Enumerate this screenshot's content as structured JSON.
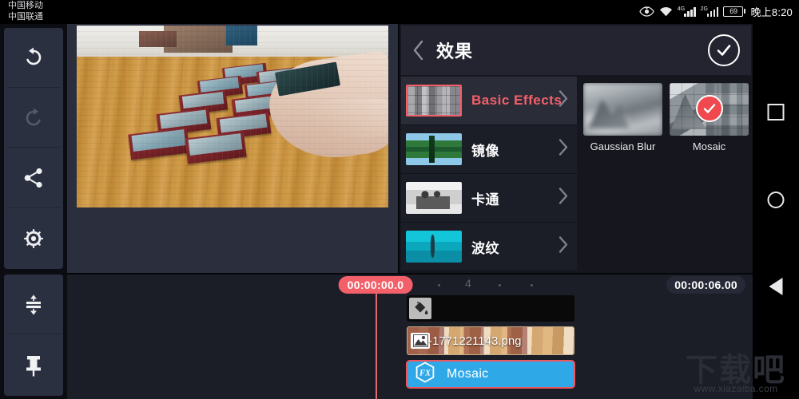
{
  "status_bar": {
    "carrier_1": "中国移动",
    "carrier_2": "中国联通",
    "icons": [
      "eye-icon",
      "wifi-icon",
      "signal-4g-icon",
      "signal-2g-icon",
      "battery-icon"
    ],
    "network_1": "4G",
    "network_2": "2G",
    "battery_percent": "69",
    "time": "晚上8:20"
  },
  "toolbar": {
    "buttons": [
      {
        "name": "undo-button",
        "icon": "undo-icon",
        "enabled": true
      },
      {
        "name": "redo-button",
        "icon": "redo-icon",
        "enabled": false
      },
      {
        "name": "share-button",
        "icon": "share-icon",
        "enabled": true
      },
      {
        "name": "settings-button",
        "icon": "gear-icon",
        "enabled": true
      },
      {
        "name": "track-height-button",
        "icon": "expand-rows-icon",
        "enabled": true
      },
      {
        "name": "pin-button",
        "icon": "pin-icon",
        "enabled": true
      }
    ]
  },
  "effects_panel": {
    "title": "效果",
    "back_icon": "chevron-left-icon",
    "confirm_icon": "check-circle-icon",
    "accent_color": "#f4606a",
    "categories": [
      {
        "label": "Basic Effects",
        "thumb": "mosaic-gray-thumb",
        "selected": true
      },
      {
        "label": "镜像",
        "thumb": "mirror-thumb",
        "selected": false
      },
      {
        "label": "卡通",
        "thumb": "cartoon-thumb",
        "selected": false
      },
      {
        "label": "波纹",
        "thumb": "ripple-thumb",
        "selected": false
      }
    ],
    "effects": [
      {
        "label": "Gaussian Blur",
        "thumb": "mountain-blur-thumb",
        "selected": false
      },
      {
        "label": "Mosaic",
        "thumb": "mountain-mosaic-thumb",
        "selected": true
      }
    ]
  },
  "timeline": {
    "playhead_time": "00:00:00.0",
    "total_duration": "00:00:06.00",
    "ruler_label": "4",
    "tracks": {
      "overlay": {
        "icon": "paint-bucket-icon",
        "label": ""
      },
      "image_clip": {
        "icon": "image-icon",
        "label": "-1771221143.png"
      },
      "effect_clip": {
        "icon": "fx-hexagon-icon",
        "label": "Mosaic",
        "color": "#2fa8e8",
        "selected": true
      }
    }
  },
  "nav_bar": {
    "recents": "square-icon",
    "home": "circle-icon",
    "back": "triangle-back-icon"
  },
  "watermark": {
    "text": "下载吧",
    "url": "www.xiazaiba.com"
  }
}
